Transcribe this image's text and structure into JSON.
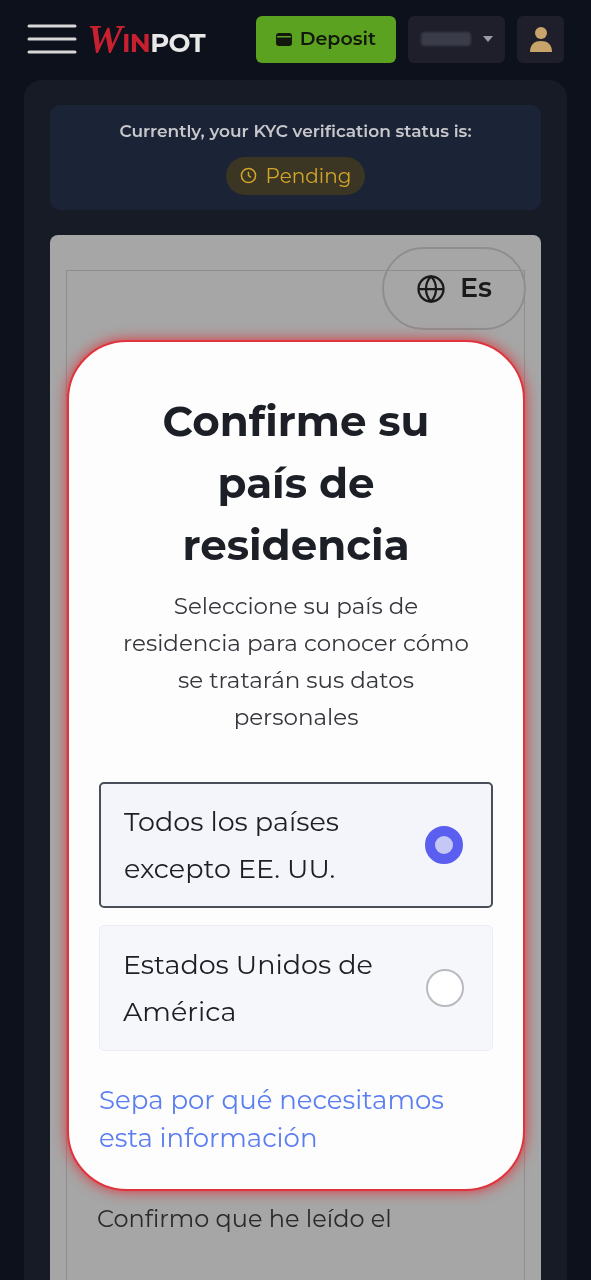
{
  "header": {
    "logo": [
      {
        "text": "W",
        "color": "#c8202f"
      },
      {
        "text": "IN",
        "color": "#c8202f"
      },
      {
        "text": "POT",
        "color": "#e8e8e8"
      }
    ],
    "deposit_button": "Deposit"
  },
  "kyc": {
    "message": "Currently, your KYC verification status is:",
    "status": "Pending"
  },
  "language_button": "Es",
  "modal": {
    "title": "Confirme su país de residencia",
    "subtitle": "Seleccione su país de residencia para conocer cómo se tratarán sus datos personales",
    "options": [
      {
        "label": "Todos los países excepto EE. UU.",
        "selected": true
      },
      {
        "label": "Estados Unidos de América",
        "selected": false
      }
    ],
    "link": "Sepa por qué necesitamos esta información"
  },
  "background_text": "Confirmo que he leído el"
}
